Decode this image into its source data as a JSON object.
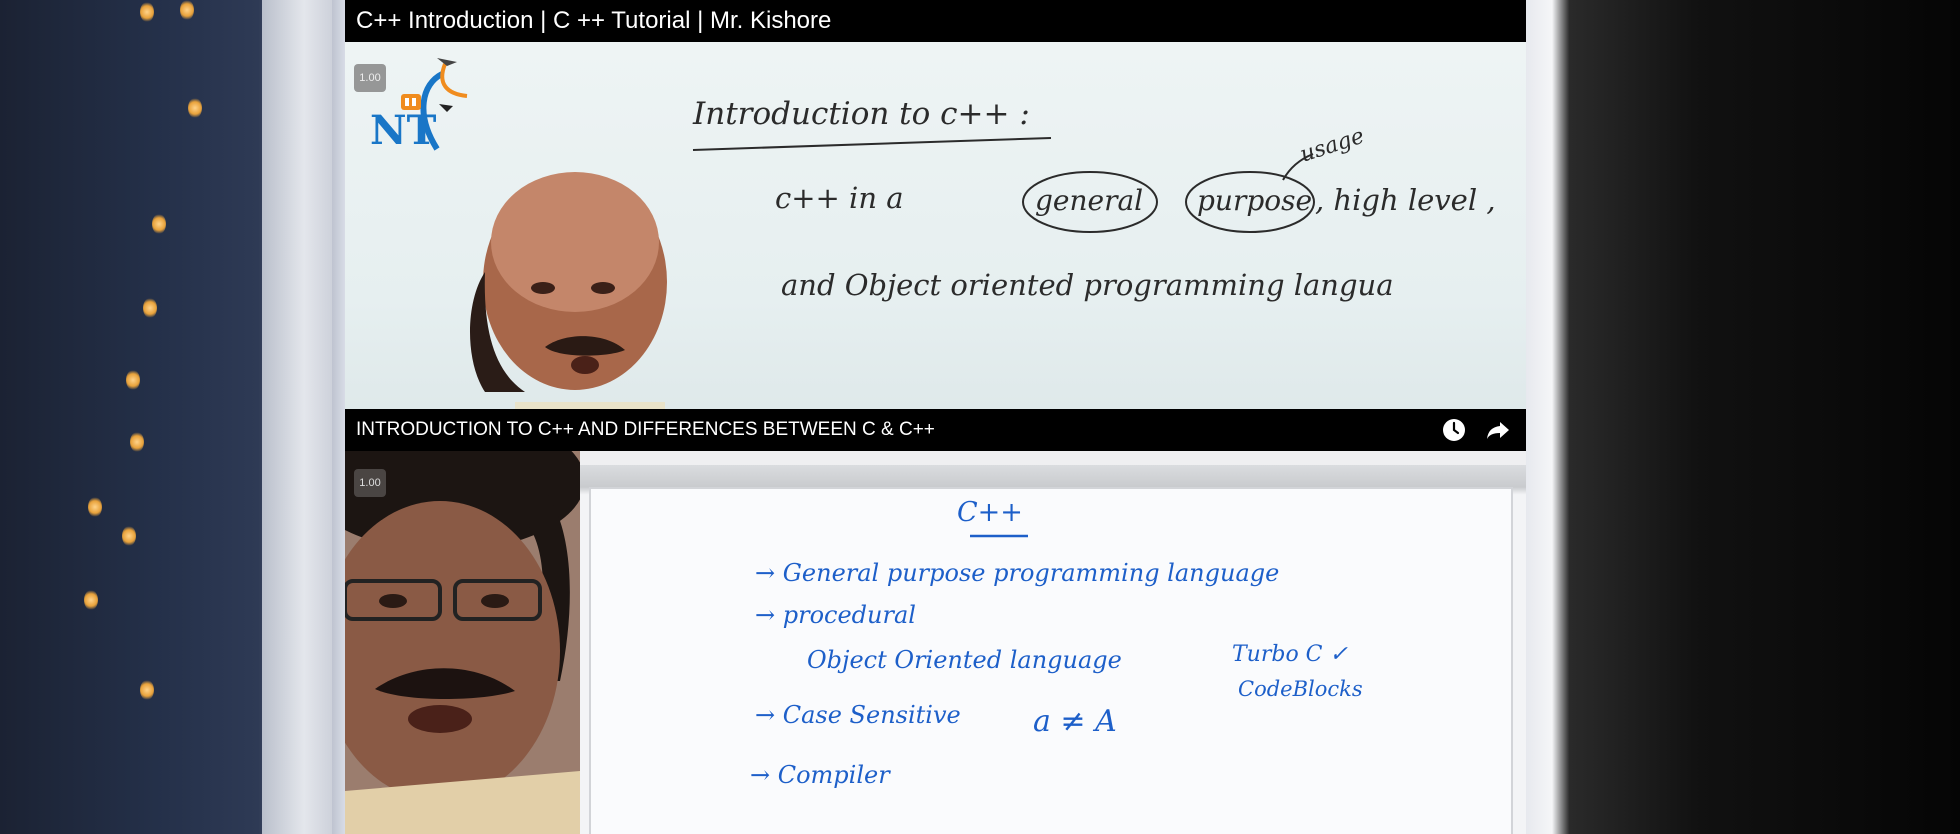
{
  "videos": [
    {
      "title": "C++ Introduction | C ++ Tutorial | Mr. Kishore",
      "speed": "1.00",
      "logo_text": "NT",
      "board_lines": [
        "Introduction  to  c++ :",
        "usage",
        "c++   in   a",
        "general",
        "purpose",
        ",  high  level ,",
        "and   Object   oriented   programming   langua"
      ]
    },
    {
      "title": "INTRODUCTION TO C++ AND DIFFERENCES BETWEEN C & C++",
      "speed": "1.00",
      "actions": [
        "Watch later",
        "Share"
      ],
      "board_lines": [
        "C++",
        "→  General  purpose  programming  language",
        "→  procedural",
        "Object  Oriented  language",
        "Turbo C ✓",
        "CodeBlocks",
        "→  Case  Sensitive",
        "a ≠ A",
        "→  Compiler"
      ]
    }
  ],
  "icons": [
    "clock-icon",
    "share-icon"
  ],
  "colors": {
    "marker_blue": "#1d5fc9",
    "marker_black": "#2b2b2b",
    "logo_blue": "#1976c7",
    "logo_orange": "#f08c1e"
  }
}
